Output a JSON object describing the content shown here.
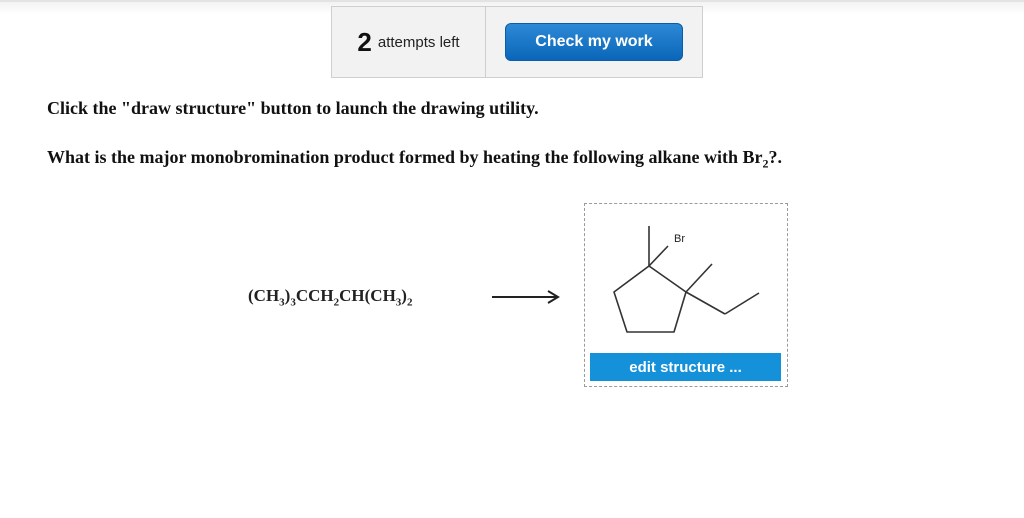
{
  "header": {
    "attempts_count": "2",
    "attempts_label": "attempts left",
    "check_button_label": "Check my work"
  },
  "question": {
    "instruction_text": "Click the \"draw structure\" button to launch the drawing utility.",
    "prompt_prefix": "What is the major monobromination product formed by heating the following alkane with Br",
    "prompt_subscript": "2",
    "prompt_suffix": "?."
  },
  "reaction": {
    "reactant_parts": [
      "(CH",
      "3",
      ")",
      "3",
      "CCH",
      "2",
      "CH(CH",
      "3",
      ")",
      "2"
    ]
  },
  "structure": {
    "atom_label": "Br",
    "edit_button_label": "edit structure ..."
  },
  "colors": {
    "button_blue": "#0a66b8",
    "edit_button_blue": "#1591d9",
    "dashed_border": "#9a9a9a"
  }
}
